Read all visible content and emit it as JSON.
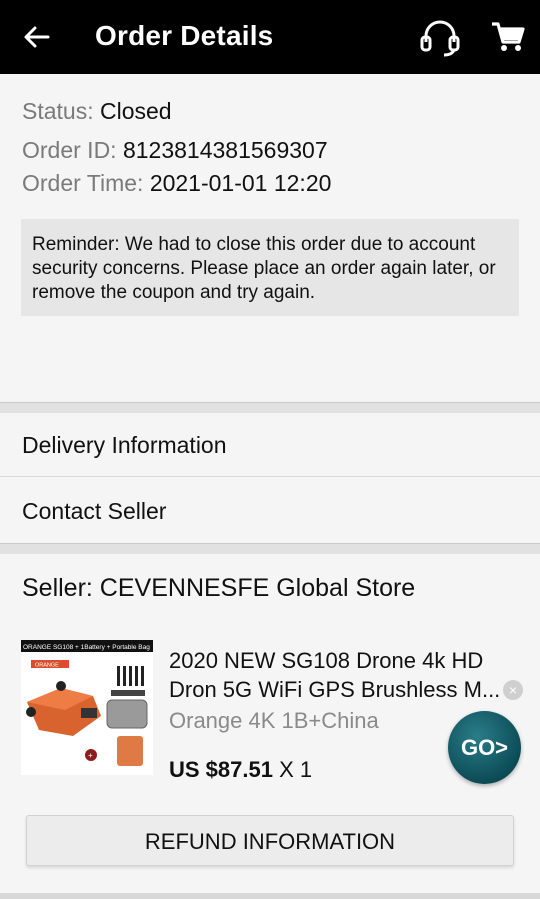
{
  "header": {
    "title": "Order Details",
    "icons": [
      "back-arrow-icon",
      "headset-support-icon",
      "cart-icon"
    ]
  },
  "status": {
    "status_label": "Status:",
    "status_value": "Closed",
    "order_id_label": "Order ID:",
    "order_id_value": "8123814381569307",
    "order_time_label": "Order Time:",
    "order_time_value": "2021-01-01 12:20",
    "reminder": "Reminder: We had to close this order due to account security concerns. Please place an order again later, or remove the coupon and try again."
  },
  "menu": {
    "delivery": "Delivery Information",
    "contact": "Contact Seller"
  },
  "seller": {
    "label": "Seller: CEVENNESFE Global Store"
  },
  "product": {
    "name_line1": "2020 NEW SG108 Drone 4k HD",
    "name_line2": "Dron 5G WiFi GPS Brushless M...",
    "variant": "Orange 4K 1B+China",
    "price": "US $87.51",
    "quantity": "X 1",
    "thumb_caption": "ORANGE SG108 + 1Battery + Portable Bag",
    "thumb_tag": "ORANGE"
  },
  "floating": {
    "go_label": "GO>",
    "close_label": "×"
  },
  "actions": {
    "refund": "REFUND INFORMATION"
  },
  "colors": {
    "header_bg": "#000000",
    "reminder_bg": "#e6e6e6",
    "go_button": "#0c4c57"
  }
}
